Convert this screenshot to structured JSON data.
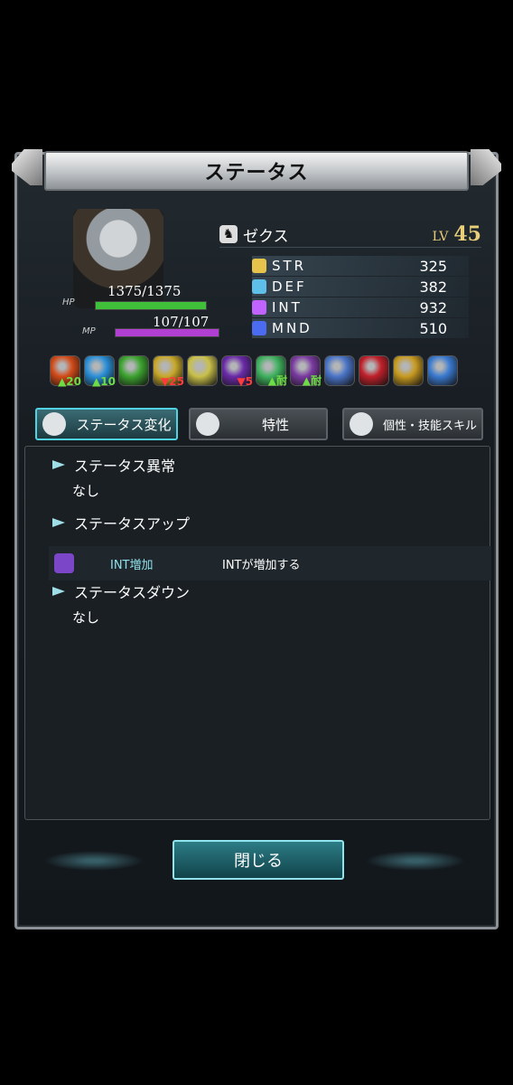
{
  "title": "ステータス",
  "character": {
    "name": "ゼクス",
    "lv_label": "LV",
    "level": "45",
    "hp_label": "HP",
    "hp_text": "1375/1375",
    "hp_fraction": 1.0,
    "mp_label": "MP",
    "mp_text": "107/107",
    "mp_fraction": 1.0
  },
  "stats": [
    {
      "name": "STR",
      "value": "325",
      "color": "#e6c34b"
    },
    {
      "name": "DEF",
      "value": "382",
      "color": "#5ec0e8"
    },
    {
      "name": "INT",
      "value": "932",
      "color": "#c063ff"
    },
    {
      "name": "MND",
      "value": "510",
      "color": "#4b6bf0"
    }
  ],
  "buffs": [
    {
      "icon": "fire-icon",
      "color": "#d24a18",
      "num": "20",
      "dir": "up"
    },
    {
      "icon": "ice-icon",
      "color": "#2a8fd8",
      "num": "10",
      "dir": "up"
    },
    {
      "icon": "wind-icon",
      "color": "#3ca32f",
      "num": "",
      "dir": ""
    },
    {
      "icon": "lightning-icon",
      "color": "#c8a82a",
      "num": "25",
      "dir": "down"
    },
    {
      "icon": "holy-icon",
      "color": "#c9c04a",
      "num": "",
      "dir": ""
    },
    {
      "icon": "dark-icon",
      "color": "#6a2aa8",
      "num": "5",
      "dir": "down"
    },
    {
      "icon": "poison-resist-icon",
      "color": "#3fb25f",
      "num": "耐",
      "dir": "up"
    },
    {
      "icon": "blind-resist-icon",
      "color": "#7a3aa0",
      "num": "耐",
      "dir": "up"
    },
    {
      "icon": "silence-icon",
      "color": "#4a74c8",
      "num": "",
      "dir": ""
    },
    {
      "icon": "death-icon",
      "color": "#c0202a",
      "num": "",
      "dir": ""
    },
    {
      "icon": "paralysis-icon",
      "color": "#c89a20",
      "num": "",
      "dir": ""
    },
    {
      "icon": "slow-icon",
      "color": "#3a7ad0",
      "num": "",
      "dir": ""
    }
  ],
  "tabs": [
    {
      "label": "ステータス変化",
      "active": true
    },
    {
      "label": "特性",
      "active": false
    },
    {
      "label": "個性・技能スキル",
      "active": false
    }
  ],
  "sections": {
    "ailment_title": "ステータス異常",
    "ailment_value": "なし",
    "up_title": "ステータスアップ",
    "up_row": {
      "name": "INT増加",
      "desc": "INTが増加する"
    },
    "down_title": "ステータスダウン",
    "down_value": "なし"
  },
  "close_label": "閉じる"
}
